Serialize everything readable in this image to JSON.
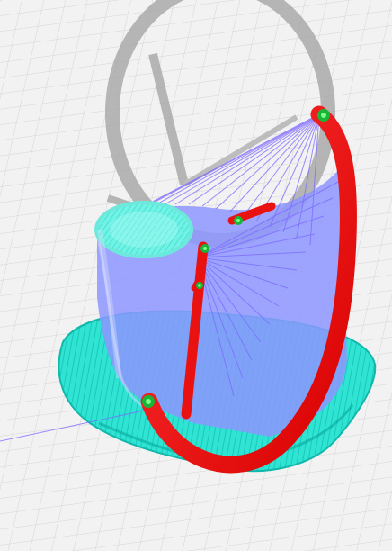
{
  "viewport": {
    "background": "#f2f2f2",
    "grid_color": "#d0d0d0"
  },
  "colors": {
    "travel_lines": "#8f7cff",
    "support_region": "#7e86ff",
    "brim": "#34e8d6",
    "brim_dark": "#0fbfb3",
    "infill": "#56f0df",
    "ghost_model": "#a9a9a9",
    "active_path": "#ff1a1a",
    "active_path_dark": "#c40000",
    "seam_marker": "#20d04a"
  },
  "icons": {
    "travel": "travel-moves-icon",
    "seam": "seam-marker-icon",
    "support": "support-structure-icon"
  }
}
